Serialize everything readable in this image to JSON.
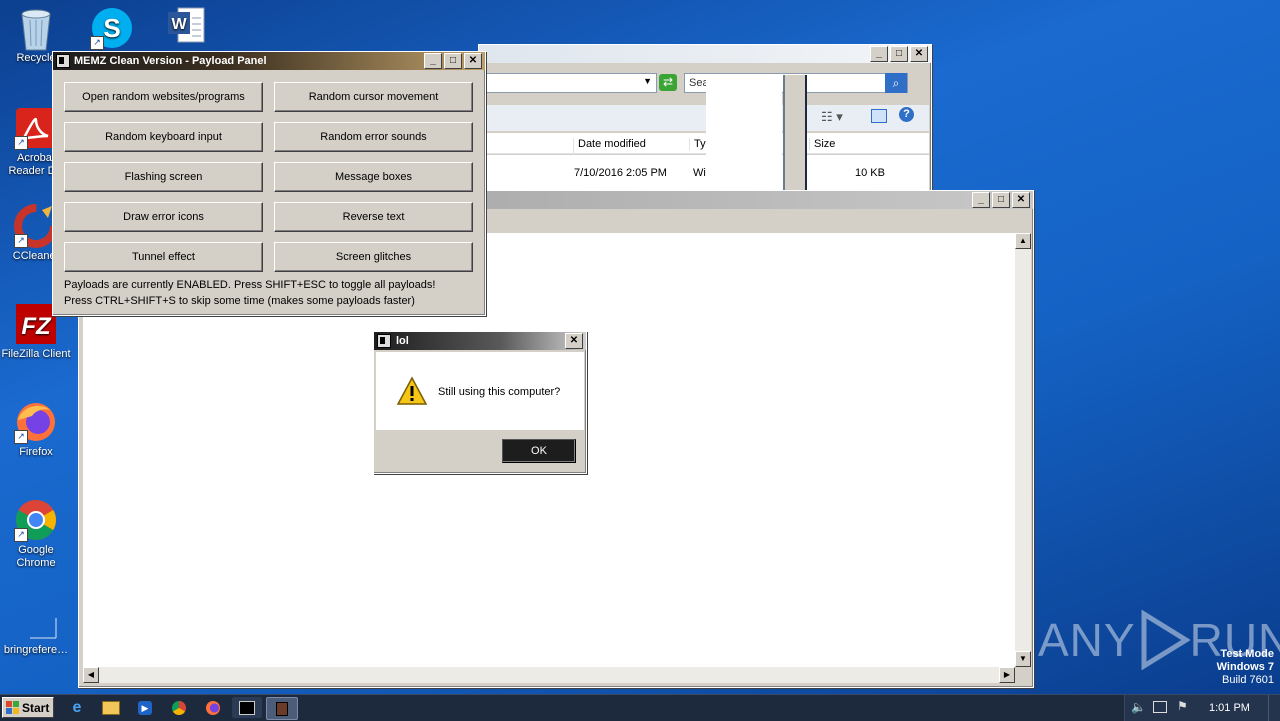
{
  "desktop": {
    "icons": [
      {
        "label": "Recycle",
        "icon": "recycle-bin-icon"
      },
      {
        "label": "Skype",
        "icon": "skype-icon"
      },
      {
        "label": "Word",
        "icon": "word-document-icon"
      },
      {
        "label": "Acrobat Reader DC",
        "label_line1": "Acrobat",
        "label_line2": "Reader DC",
        "icon": "acrobat-reader-icon"
      },
      {
        "label": "CCleaner",
        "icon": "ccleaner-icon"
      },
      {
        "label": "FileZilla Client",
        "icon": "filezilla-icon"
      },
      {
        "label": "Firefox",
        "icon": "firefox-icon"
      },
      {
        "label": "Google Chrome",
        "label_line1": "Google",
        "label_line2": "Chrome",
        "icon": "chrome-icon"
      },
      {
        "label": "bringrefere…",
        "icon": "file-icon"
      }
    ],
    "watermark": {
      "text": "ANY▷RUN",
      "left": "ANY",
      "right": "RUN"
    },
    "os_info": {
      "line1": "Test Mode",
      "line2": "Windows 7",
      "line3": "Build 7601"
    }
  },
  "explorer": {
    "search_placeholder": "Sea",
    "columns": [
      "Date modified",
      "Ty",
      "Size"
    ],
    "row": {
      "date": "7/10/2016 2:05 PM",
      "type": "Wi",
      "size": "10 KB"
    }
  },
  "memz": {
    "title": "MEMZ Clean Version - Payload Panel",
    "buttons": [
      "Open random websites/programs",
      "Random cursor movement",
      "Random keyboard input",
      "Random error sounds",
      "Flashing screen",
      "Message boxes",
      "Draw error icons",
      "Reverse text",
      "Tunnel effect",
      "Screen glitches"
    ],
    "status1": "Payloads are currently ENABLED. Press SHIFT+ESC to toggle all payloads!",
    "status2": "Press CTRL+SHIFT+S to skip some time (makes some payloads faster)"
  },
  "dialog": {
    "title": "lol",
    "message": "Still using this computer?",
    "ok": "OK"
  },
  "taskbar": {
    "start": "Start",
    "clock": "1:01 PM",
    "apps": [
      "ie-icon",
      "explorer-icon",
      "media-player-icon",
      "chrome-icon",
      "firefox-icon",
      "terminal-icon",
      "memz-icon"
    ]
  },
  "colors": {
    "titlebar_active": "#1d2a3d",
    "memz_title_gradient_end": "#bfa06a"
  }
}
